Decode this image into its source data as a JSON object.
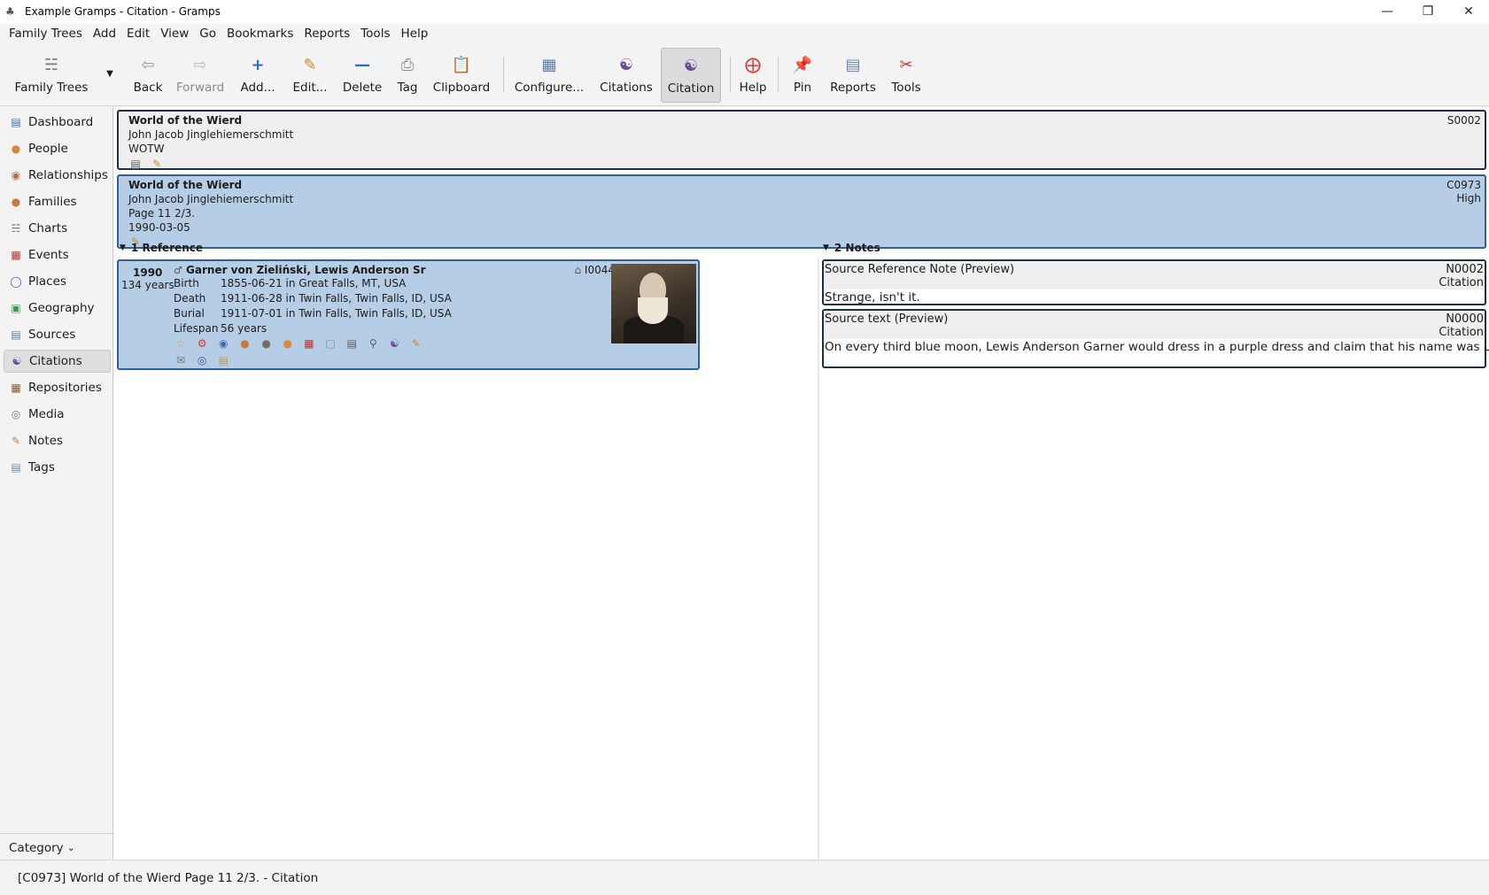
{
  "window": {
    "title": "Example Gramps - Citation - Gramps",
    "controls": [
      "minimize-icon",
      "restore-icon",
      "close-icon"
    ]
  },
  "menubar": [
    "Family Trees",
    "Add",
    "Edit",
    "View",
    "Go",
    "Bookmarks",
    "Reports",
    "Tools",
    "Help"
  ],
  "toolbar": {
    "family_trees": "Family Trees",
    "back": "Back",
    "forward": "Forward",
    "add": "Add...",
    "edit": "Edit...",
    "delete": "Delete",
    "tag": "Tag",
    "clipboard": "Clipboard",
    "configure": "Configure...",
    "citations": "Citations",
    "citation": "Citation",
    "help": "Help",
    "pin": "Pin",
    "reports": "Reports",
    "tools": "Tools"
  },
  "sidebar": {
    "items": [
      {
        "label": "Dashboard",
        "icon": "dashboard-icon"
      },
      {
        "label": "People",
        "icon": "person-icon"
      },
      {
        "label": "Relationships",
        "icon": "relationships-icon"
      },
      {
        "label": "Families",
        "icon": "families-icon"
      },
      {
        "label": "Charts",
        "icon": "charts-icon"
      },
      {
        "label": "Events",
        "icon": "calendar-icon"
      },
      {
        "label": "Places",
        "icon": "globe-icon"
      },
      {
        "label": "Geography",
        "icon": "map-icon"
      },
      {
        "label": "Sources",
        "icon": "book-icon"
      },
      {
        "label": "Citations",
        "icon": "citation-icon"
      },
      {
        "label": "Repositories",
        "icon": "repository-icon"
      },
      {
        "label": "Media",
        "icon": "media-icon"
      },
      {
        "label": "Notes",
        "icon": "note-icon"
      },
      {
        "label": "Tags",
        "icon": "tag-icon"
      }
    ],
    "active": "Citations",
    "category_label": "Category"
  },
  "source_card": {
    "title": "World of the Wierd",
    "author": "John Jacob Jinglehiemerschmitt",
    "abbrev": "WOTW",
    "id": "S0002"
  },
  "citation_card": {
    "title": "World of the Wierd",
    "author": "John Jacob Jinglehiemerschmitt",
    "page": "Page 11 2/3.",
    "date": "1990-03-05",
    "id": "C0973",
    "confidence": "High"
  },
  "references": {
    "header": "1 Reference",
    "person": {
      "year": "1990",
      "age": "134 years",
      "name": "Garner von Zieliński, Lewis Anderson Sr",
      "id": "I0044",
      "events": [
        {
          "type": "Birth",
          "detail": "1855-06-21 in Great Falls, MT, USA"
        },
        {
          "type": "Death",
          "detail": "1911-06-28 in Twin Falls, Twin Falls, ID, USA"
        },
        {
          "type": "Burial",
          "detail": "1911-07-01 in Twin Falls, Twin Falls, ID, USA"
        }
      ],
      "lifespan_label": "Lifespan",
      "lifespan_value": "56 years"
    }
  },
  "notes": {
    "header": "2 Notes",
    "items": [
      {
        "title": "Source Reference Note (Preview)",
        "id": "N0002",
        "type": "Citation",
        "text": "Strange, isn't it."
      },
      {
        "title": "Source text (Preview)",
        "id": "N0000",
        "type": "Citation",
        "text": "On every third blue moon, Lewis Anderson Garner would dress in a purple dress and claim that his name was Louis Garner."
      }
    ]
  },
  "statusbar": {
    "text": "[C0973] World of the Wierd Page 11 2/3. - Citation"
  }
}
